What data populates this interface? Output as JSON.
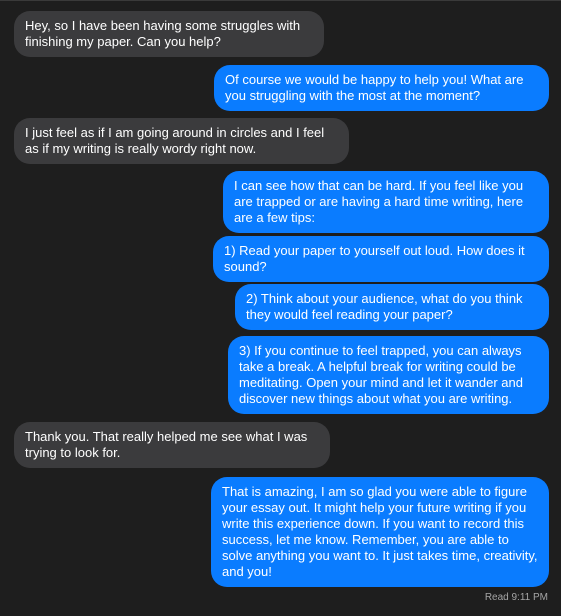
{
  "messages": [
    {
      "direction": "incoming",
      "text": "Hey, so I have been having some struggles with finishing my paper. Can you help?"
    },
    {
      "direction": "outgoing",
      "text": "Of course we would be happy to help you! What are you struggling with the most at the moment?"
    },
    {
      "direction": "incoming",
      "text": "I just feel as if I am going around in circles and I feel as if my writing is really wordy right now."
    },
    {
      "direction": "outgoing",
      "text": "I can see how that can be hard. If you feel like you are trapped or are having a hard time writing, here are a few tips:"
    },
    {
      "direction": "outgoing",
      "text": "1) Read your paper to yourself out loud. How does it sound?"
    },
    {
      "direction": "outgoing",
      "text": "2) Think about your audience, what do you think they would feel reading your paper?"
    },
    {
      "direction": "outgoing",
      "text": "3) If you continue to feel trapped, you can always take a break. A helpful break for writing could be meditating. Open your mind and let it wander and discover new things about what you are writing."
    },
    {
      "direction": "incoming",
      "text": "Thank you. That really helped me see what I was trying to look for."
    },
    {
      "direction": "outgoing",
      "text": "That is amazing, I am so glad you were able to figure your essay out. It might help your future writing if you write this experience down. If you want to record this success, let me know. Remember, you are able to solve anything you want to. It just takes time, creativity, and you!"
    }
  ],
  "read_receipt": "Read 9:11 PM",
  "colors": {
    "background": "#1e1e1e",
    "incoming_bubble": "#3b3b3d",
    "outgoing_bubble": "#0a7cff",
    "receipt_text": "#a5a5a5"
  }
}
